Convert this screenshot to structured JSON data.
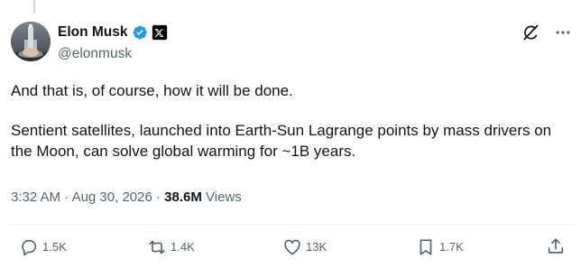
{
  "author": {
    "display_name": "Elon Musk",
    "handle": "@elonmusk",
    "avatar_icon": "rocket-launch-photo",
    "verified_color": "#1d9bf0"
  },
  "tweet": {
    "paragraphs": [
      "And that is, of course, how it will be done.",
      "Sentient satellites, launched into Earth-Sun Lagrange points by mass drivers on the Moon, can solve global warming for ~1B years."
    ],
    "time": "3:32 AM",
    "separator": "·",
    "date": "Aug 30, 2026",
    "views_count": "38.6M",
    "views_label": "Views"
  },
  "actions": {
    "reply": {
      "icon": "reply-icon",
      "count": "1.5K"
    },
    "retweet": {
      "icon": "retweet-icon",
      "count": "1.4K"
    },
    "like": {
      "icon": "like-icon",
      "count": "13K"
    },
    "bookmark": {
      "icon": "bookmark-icon",
      "count": "1.7K"
    },
    "share": {
      "icon": "share-icon"
    }
  },
  "colors": {
    "text": "#0f1419",
    "secondary": "#536471",
    "accent": "#1d9bf0"
  }
}
